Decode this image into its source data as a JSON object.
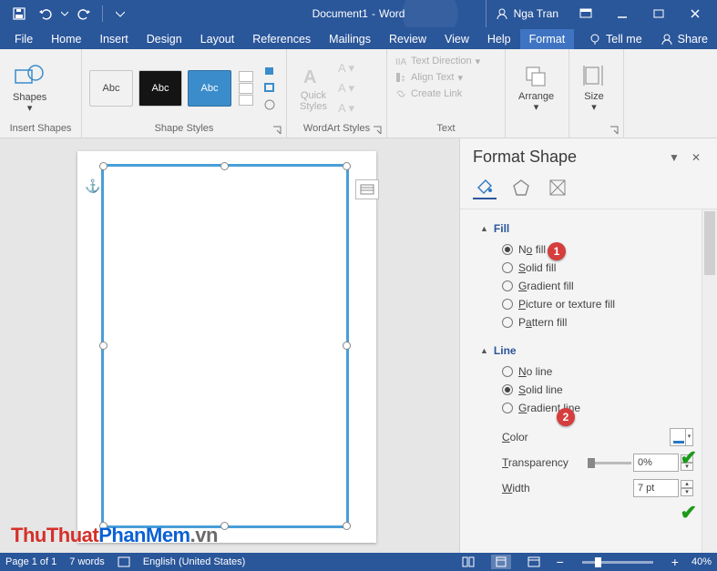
{
  "title": {
    "doc": "Document1",
    "app": "Word"
  },
  "user": {
    "name": "Nga Tran"
  },
  "qat": {
    "save": "Save",
    "undo": "Undo",
    "redo": "Redo",
    "customize": "Customize"
  },
  "tabs": {
    "file": "File",
    "home": "Home",
    "insert": "Insert",
    "design": "Design",
    "layout": "Layout",
    "references": "References",
    "mailings": "Mailings",
    "review": "Review",
    "view": "View",
    "help": "Help",
    "format": "Format",
    "tellme": "Tell me",
    "share": "Share"
  },
  "ribbon": {
    "insert_shapes": {
      "shapes": "Shapes",
      "group": "Insert Shapes"
    },
    "shape_styles": {
      "abc": "Abc",
      "group": "Shape Styles"
    },
    "wordart": {
      "quick": "Quick",
      "styles": "Styles",
      "group": "WordArt Styles"
    },
    "text": {
      "direction": "Text Direction",
      "align": "Align Text",
      "link": "Create Link",
      "group": "Text"
    },
    "arrange": {
      "label": "Arrange"
    },
    "size": {
      "label": "Size"
    }
  },
  "pane": {
    "title": "Format Shape",
    "fill": {
      "head": "Fill",
      "no_fill": "No fill",
      "solid": "Solid fill",
      "gradient": "Gradient fill",
      "picture": "Picture or texture fill",
      "pattern": "Pattern fill",
      "selected": "no_fill"
    },
    "line": {
      "head": "Line",
      "no_line": "No line",
      "solid": "Solid line",
      "gradient": "Gradient line",
      "selected": "solid"
    },
    "color_label": "Color",
    "transparency_label": "Transparency",
    "transparency_value": "0%",
    "width_label": "Width",
    "width_value": "7 pt"
  },
  "callouts": {
    "one": "1",
    "two": "2"
  },
  "status": {
    "page": "Page 1 of 1",
    "words": "7 words",
    "lang": "English (United States)",
    "zoom": "40%"
  },
  "watermark": {
    "a": "ThuThuat",
    "b": "PhanMem",
    "c": ".vn"
  }
}
